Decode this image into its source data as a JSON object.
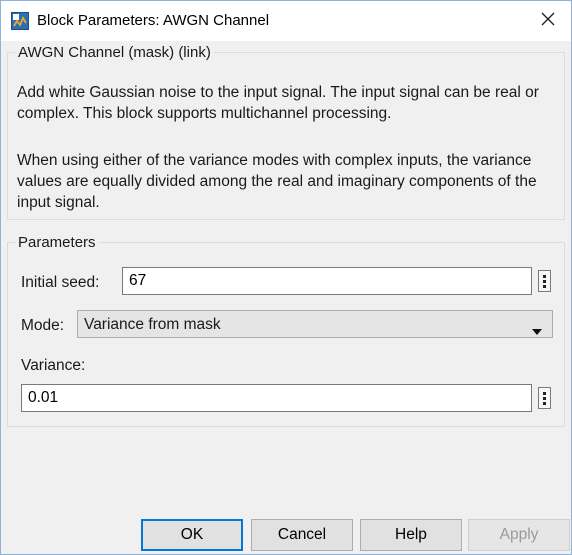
{
  "window": {
    "title": "Block Parameters: AWGN Channel"
  },
  "mask": {
    "group_label": "AWGN Channel (mask) (link)",
    "description_1": "Add white Gaussian noise to the input signal. The input signal can be real or complex. This block supports multichannel processing.",
    "description_2": "When using either of the variance modes with complex inputs, the variance values are equally divided among the real and imaginary components of the input signal."
  },
  "parameters": {
    "group_label": "Parameters",
    "initial_seed_label": "Initial seed:",
    "initial_seed_value": "67",
    "mode_label": "Mode:",
    "mode_value": "Variance from mask",
    "variance_label": "Variance:",
    "variance_value": "0.01"
  },
  "buttons": {
    "ok": "OK",
    "cancel": "Cancel",
    "help": "Help",
    "apply": "Apply"
  },
  "icons": {
    "app": "simulink-block-icon",
    "close": "close-icon",
    "dropdown": "chevron-down-icon",
    "more": "more-vertical-icon"
  },
  "colors": {
    "window_bg": "#f0f0f0",
    "titlebar_bg": "#ffffff",
    "default_button_border": "#0078d7",
    "window_border": "#8fb3d6"
  }
}
